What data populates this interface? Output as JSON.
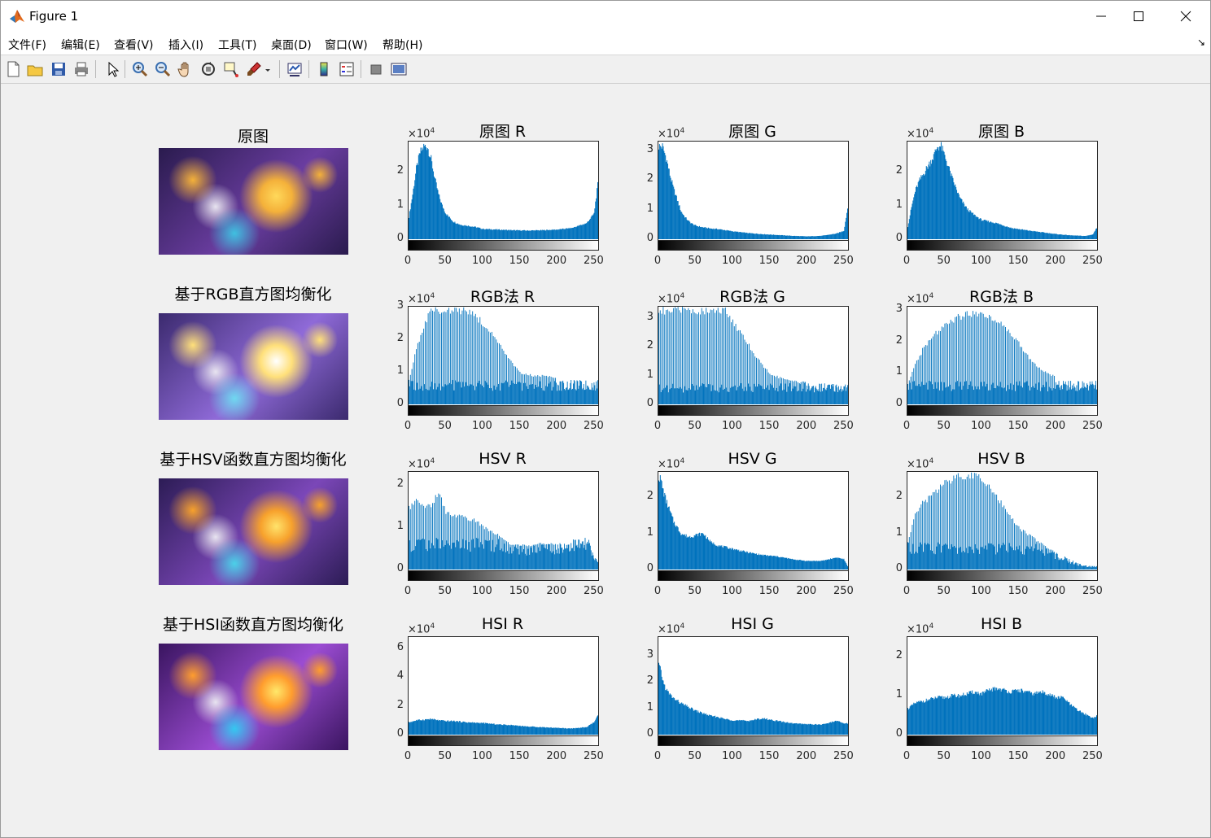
{
  "window": {
    "title": "Figure 1",
    "minimize_icon": "minimize-icon",
    "maximize_icon": "maximize-icon",
    "close_icon": "close-icon"
  },
  "menu": [
    "文件(F)",
    "编辑(E)",
    "查看(V)",
    "插入(I)",
    "工具(T)",
    "桌面(D)",
    "窗口(W)",
    "帮助(H)"
  ],
  "menu_arrow": "↘",
  "toolbar": [
    "new-figure-icon",
    "open-file-icon",
    "save-icon",
    "print-icon",
    "pointer-icon",
    "zoom-in-icon",
    "zoom-out-icon",
    "pan-icon",
    "rotate-3d-icon",
    "data-cursor-icon",
    "brush-icon",
    "link-plot-icon",
    "colorbar-icon",
    "legend-icon",
    "hide-plot-tools-icon",
    "show-plot-tools-icon"
  ],
  "row_titles": [
    "原图",
    "基于RGB直方图均衡化",
    "基于HSV函数直方图均衡化",
    "基于HSI函数直方图均衡化"
  ],
  "exponent": "×10",
  "exponent_power": "4",
  "x_ticks": [
    "0",
    "50",
    "100",
    "150",
    "200",
    "250"
  ],
  "chart_data": [
    {
      "type": "bar",
      "title": "原图 R",
      "xlim": [
        0,
        255
      ],
      "ylim": [
        0,
        2.9
      ],
      "y_ticks": [
        "0",
        "1",
        "2"
      ],
      "y_tick_values": [
        0,
        1,
        2
      ],
      "x": [
        0,
        5,
        10,
        15,
        20,
        25,
        30,
        35,
        40,
        45,
        50,
        60,
        70,
        80,
        90,
        100,
        120,
        140,
        160,
        180,
        200,
        220,
        240,
        250,
        255
      ],
      "y": [
        0.7,
        1.4,
        2.2,
        2.7,
        2.9,
        2.9,
        2.5,
        1.9,
        1.4,
        1.05,
        0.8,
        0.55,
        0.45,
        0.42,
        0.38,
        0.32,
        0.3,
        0.28,
        0.27,
        0.28,
        0.3,
        0.35,
        0.5,
        0.8,
        1.7
      ]
    },
    {
      "type": "bar",
      "title": "原图 G",
      "xlim": [
        0,
        255
      ],
      "ylim": [
        0,
        3.3
      ],
      "y_ticks": [
        "0",
        "1",
        "2",
        "3"
      ],
      "y_tick_values": [
        0,
        1,
        2,
        3
      ],
      "x": [
        0,
        5,
        10,
        15,
        20,
        25,
        30,
        35,
        40,
        45,
        50,
        60,
        70,
        80,
        90,
        100,
        120,
        140,
        160,
        180,
        200,
        220,
        240,
        250,
        255
      ],
      "y": [
        3.3,
        3.3,
        2.9,
        2.3,
        1.8,
        1.4,
        1.0,
        0.8,
        0.65,
        0.55,
        0.48,
        0.42,
        0.38,
        0.36,
        0.32,
        0.28,
        0.22,
        0.18,
        0.15,
        0.12,
        0.1,
        0.12,
        0.2,
        0.3,
        1.1
      ]
    },
    {
      "type": "bar",
      "title": "原图 B",
      "xlim": [
        0,
        255
      ],
      "ylim": [
        0,
        2.9
      ],
      "y_ticks": [
        "0",
        "1",
        "2"
      ],
      "y_tick_values": [
        0,
        1,
        2
      ],
      "x": [
        0,
        5,
        10,
        15,
        20,
        25,
        30,
        35,
        40,
        45,
        50,
        60,
        70,
        80,
        90,
        100,
        120,
        140,
        160,
        180,
        200,
        220,
        240,
        250,
        255
      ],
      "y": [
        0.4,
        1.0,
        1.5,
        1.8,
        2.0,
        2.2,
        2.4,
        2.6,
        2.9,
        2.9,
        2.6,
        1.9,
        1.3,
        0.95,
        0.75,
        0.6,
        0.5,
        0.35,
        0.28,
        0.22,
        0.16,
        0.12,
        0.1,
        0.15,
        0.35
      ]
    },
    {
      "type": "bar",
      "title": "RGB法 R",
      "xlim": [
        0,
        255
      ],
      "ylim": [
        0,
        3.0
      ],
      "y_ticks": [
        "0",
        "1",
        "2",
        "3"
      ],
      "y_tick_values": [
        0,
        1,
        2,
        3
      ],
      "style": "spikes",
      "x": [
        0,
        5,
        10,
        20,
        30,
        40,
        50,
        60,
        70,
        80,
        90,
        100,
        110,
        120,
        130,
        140,
        150,
        160,
        170,
        180,
        190,
        200,
        210,
        220,
        230,
        240,
        250,
        255
      ],
      "y": [
        0.8,
        1.2,
        1.8,
        2.5,
        3.0,
        3.0,
        3.0,
        3.0,
        3.0,
        3.0,
        2.8,
        2.6,
        2.3,
        2.0,
        1.6,
        1.3,
        1.0,
        0.95,
        0.9,
        0.92,
        0.88,
        0.85,
        0.8,
        0.85,
        0.95,
        0.9,
        1.2,
        0.8
      ]
    },
    {
      "type": "bar",
      "title": "RGB法 G",
      "xlim": [
        0,
        255
      ],
      "ylim": [
        0,
        3.4
      ],
      "y_ticks": [
        "0",
        "1",
        "2",
        "3"
      ],
      "y_tick_values": [
        0,
        1,
        2,
        3
      ],
      "style": "spikes",
      "x": [
        0,
        5,
        10,
        20,
        30,
        40,
        50,
        60,
        70,
        80,
        90,
        100,
        110,
        120,
        130,
        140,
        150,
        160,
        170,
        180,
        190,
        200,
        210,
        220,
        230,
        240,
        250,
        255
      ],
      "y": [
        3.4,
        3.4,
        3.4,
        3.4,
        3.4,
        3.4,
        3.4,
        3.4,
        3.4,
        3.4,
        3.4,
        3.0,
        2.6,
        2.2,
        1.8,
        1.45,
        1.1,
        1.0,
        0.9,
        0.85,
        0.8,
        0.8,
        0.75,
        0.75,
        0.75,
        0.8,
        0.9,
        0.8
      ]
    },
    {
      "type": "bar",
      "title": "RGB法 B",
      "xlim": [
        0,
        255
      ],
      "ylim": [
        0,
        3.1
      ],
      "y_ticks": [
        "0",
        "1",
        "2",
        "3"
      ],
      "y_tick_values": [
        0,
        1,
        2,
        3
      ],
      "style": "spikes",
      "x": [
        0,
        5,
        10,
        20,
        30,
        40,
        50,
        60,
        70,
        80,
        90,
        100,
        110,
        120,
        130,
        140,
        150,
        160,
        170,
        180,
        190,
        200,
        210,
        220,
        230,
        240,
        250,
        255
      ],
      "y": [
        0.7,
        1.0,
        1.3,
        1.8,
        2.1,
        2.4,
        2.6,
        2.8,
        2.9,
        3.0,
        3.0,
        3.0,
        2.9,
        2.8,
        2.6,
        2.3,
        2.0,
        1.7,
        1.35,
        1.15,
        1.0,
        0.95,
        0.9,
        0.85,
        0.82,
        0.8,
        0.85,
        0.8
      ]
    },
    {
      "type": "bar",
      "title": "HSV R",
      "xlim": [
        0,
        255
      ],
      "ylim": [
        0,
        2.3
      ],
      "y_ticks": [
        "0",
        "1",
        "2"
      ],
      "y_tick_values": [
        0,
        1,
        2
      ],
      "style": "spikes",
      "x": [
        0,
        5,
        10,
        20,
        30,
        40,
        50,
        60,
        70,
        80,
        90,
        100,
        110,
        120,
        130,
        140,
        150,
        160,
        170,
        180,
        190,
        200,
        210,
        220,
        230,
        240,
        250,
        255
      ],
      "y": [
        1.5,
        1.6,
        1.7,
        1.55,
        1.55,
        1.9,
        1.4,
        1.3,
        1.35,
        1.25,
        1.2,
        1.05,
        0.95,
        0.85,
        0.7,
        0.6,
        0.6,
        0.58,
        0.6,
        0.65,
        0.62,
        0.64,
        0.7,
        0.75,
        0.8,
        0.95,
        0.3,
        0.3
      ]
    },
    {
      "type": "bar",
      "title": "HSV G",
      "xlim": [
        0,
        255
      ],
      "ylim": [
        0,
        2.7
      ],
      "y_ticks": [
        "0",
        "1",
        "2"
      ],
      "y_tick_values": [
        0,
        1,
        2
      ],
      "x": [
        0,
        3,
        6,
        10,
        15,
        20,
        30,
        40,
        50,
        60,
        70,
        80,
        90,
        100,
        120,
        140,
        160,
        180,
        200,
        220,
        230,
        240,
        250,
        255
      ],
      "y": [
        2.7,
        2.6,
        2.3,
        2.0,
        1.7,
        1.4,
        1.05,
        0.95,
        1.0,
        1.05,
        0.8,
        0.7,
        0.65,
        0.6,
        0.5,
        0.42,
        0.38,
        0.3,
        0.25,
        0.25,
        0.3,
        0.35,
        0.3,
        0.1
      ]
    },
    {
      "type": "bar",
      "title": "HSV B",
      "xlim": [
        0,
        255
      ],
      "ylim": [
        0,
        2.7
      ],
      "y_ticks": [
        "0",
        "1",
        "2"
      ],
      "y_tick_values": [
        0,
        1,
        2
      ],
      "style": "spikes",
      "x": [
        0,
        5,
        10,
        20,
        30,
        40,
        50,
        60,
        70,
        80,
        90,
        100,
        110,
        120,
        130,
        140,
        150,
        160,
        170,
        180,
        190,
        200,
        210,
        220,
        230,
        240,
        250,
        255
      ],
      "y": [
        0.8,
        1.2,
        1.6,
        1.9,
        2.1,
        2.3,
        2.5,
        2.6,
        2.7,
        2.7,
        2.7,
        2.6,
        2.4,
        2.1,
        1.8,
        1.5,
        1.2,
        1.05,
        0.9,
        0.75,
        0.6,
        0.5,
        0.38,
        0.28,
        0.18,
        0.12,
        0.1,
        0.1
      ]
    },
    {
      "type": "bar",
      "title": "HSI R",
      "xlim": [
        0,
        255
      ],
      "ylim": [
        0,
        6.8
      ],
      "y_ticks": [
        "0",
        "2",
        "4",
        "6"
      ],
      "y_tick_values": [
        0,
        2,
        4,
        6
      ],
      "x": [
        0,
        10,
        20,
        30,
        40,
        50,
        60,
        80,
        100,
        120,
        140,
        160,
        180,
        200,
        220,
        240,
        250,
        255
      ],
      "y": [
        0.9,
        1.05,
        1.1,
        1.15,
        1.05,
        1.0,
        1.0,
        0.9,
        0.85,
        0.75,
        0.7,
        0.6,
        0.55,
        0.5,
        0.45,
        0.55,
        0.9,
        1.4
      ]
    },
    {
      "type": "bar",
      "title": "HSI G",
      "xlim": [
        0,
        255
      ],
      "ylim": [
        0,
        3.7
      ],
      "y_ticks": [
        "0",
        "1",
        "2",
        "3"
      ],
      "y_tick_values": [
        0,
        1,
        2,
        3
      ],
      "x": [
        0,
        3,
        6,
        10,
        15,
        20,
        30,
        40,
        50,
        60,
        70,
        80,
        90,
        100,
        120,
        140,
        160,
        180,
        200,
        220,
        240,
        250,
        255
      ],
      "y": [
        2.8,
        2.5,
        2.1,
        1.8,
        1.6,
        1.45,
        1.25,
        1.1,
        0.95,
        0.85,
        0.75,
        0.7,
        0.62,
        0.58,
        0.55,
        0.65,
        0.55,
        0.45,
        0.42,
        0.4,
        0.55,
        0.45,
        0.45
      ]
    },
    {
      "type": "bar",
      "title": "HSI B",
      "xlim": [
        0,
        255
      ],
      "ylim": [
        0,
        2.5
      ],
      "y_ticks": [
        "0",
        "1",
        "2"
      ],
      "y_tick_values": [
        0,
        1,
        2
      ],
      "x": [
        0,
        10,
        20,
        30,
        40,
        50,
        60,
        70,
        80,
        90,
        100,
        110,
        120,
        130,
        140,
        150,
        160,
        170,
        180,
        190,
        200,
        210,
        220,
        230,
        240,
        250,
        255
      ],
      "y": [
        0.7,
        0.85,
        0.9,
        0.95,
        1.0,
        1.0,
        1.05,
        1.05,
        1.1,
        1.15,
        1.1,
        1.2,
        1.25,
        1.2,
        1.15,
        1.2,
        1.15,
        1.1,
        1.15,
        1.1,
        1.0,
        1.0,
        0.8,
        0.65,
        0.55,
        0.45,
        0.5
      ]
    }
  ]
}
